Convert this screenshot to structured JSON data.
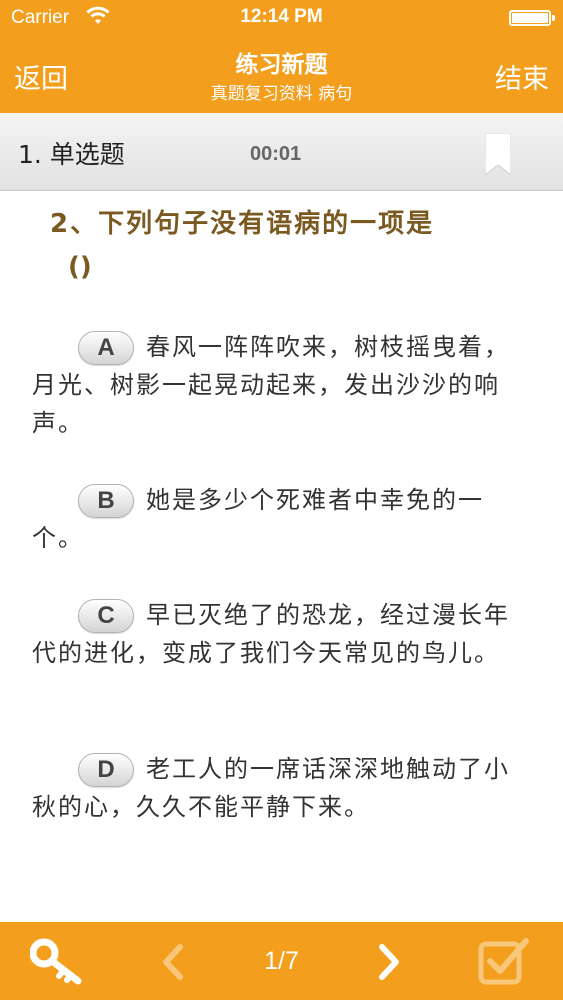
{
  "status_bar": {
    "carrier": "Carrier",
    "time": "12:14 PM",
    "wifi_icon": "wifi-icon",
    "battery_icon": "battery-icon"
  },
  "nav": {
    "back_label": "返回",
    "title": "练习新题",
    "subtitle": "真题复习资料 病句",
    "end_label": "结束"
  },
  "question_bar": {
    "type_label": "1. 单选题",
    "timer": "00:01",
    "bookmark_icon": "bookmark-icon"
  },
  "question": {
    "text": "2、下列句子没有语病的一项是",
    "blank": "()"
  },
  "options": [
    {
      "letter": "A",
      "text": "春风一阵阵吹来，树枝摇曳着，月光、树影一起晃动起来，发出沙沙的响声。"
    },
    {
      "letter": "B",
      "text": "她是多少个死难者中幸免的一个。"
    },
    {
      "letter": "C",
      "text": "早已灭绝了的恐龙，经过漫长年代的进化，变成了我们今天常见的鸟儿。"
    },
    {
      "letter": "D",
      "text": "老工人的一席话深深地触动了小秋的心，久久不能平静下来。"
    }
  ],
  "toolbar": {
    "page_indicator": "1/7",
    "key_icon": "key-icon",
    "prev_icon": "chevron-left-icon",
    "next_icon": "chevron-right-icon",
    "submit_icon": "checkbox-icon"
  },
  "colors": {
    "accent": "#f39f1d",
    "question_text": "#7b5a22"
  }
}
